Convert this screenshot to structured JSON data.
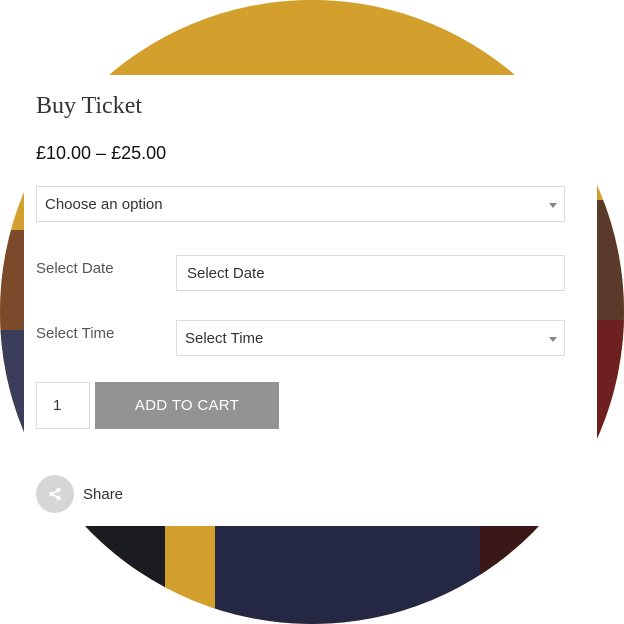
{
  "product": {
    "title": "Buy Ticket",
    "price_range": "£10.00 – £25.00"
  },
  "variation_select": {
    "selected": "Choose an option",
    "icon": "chevron-down-icon"
  },
  "date_field": {
    "label": "Select Date",
    "placeholder": "Select Date"
  },
  "time_field": {
    "label": "Select Time",
    "selected": "Select Time",
    "icon": "chevron-down-icon"
  },
  "cart": {
    "quantity": "1",
    "button_label": "ADD TO CART"
  },
  "share": {
    "label": "Share",
    "icon": "share-icon"
  },
  "colors": {
    "accent_gold": "#d4a02d",
    "button_gray": "#939393",
    "border": "#dddddd"
  }
}
